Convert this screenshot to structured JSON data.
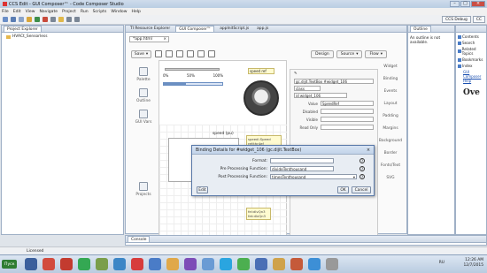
{
  "window": {
    "title": "CCS Edit - GUI Composer™ - Code Composer Studio"
  },
  "menu": [
    "File",
    "Edit",
    "View",
    "Navigate",
    "Project",
    "Run",
    "Scripts",
    "Window",
    "Help"
  ],
  "perspectives": [
    "CCS Debug",
    "CC"
  ],
  "explorer": {
    "tab": "Project Explorer",
    "items": [
      "HVACt_Sensorless"
    ]
  },
  "editor": {
    "tabs": [
      "TI Resource Explorer",
      "GUI Composer™",
      "appInitScript.js",
      "app.js"
    ],
    "file_tab": "*app.html",
    "save": "Save",
    "design": "Design",
    "source": "Source",
    "flow": "Flow",
    "palette": [
      "Palette",
      "Outline",
      "GUI Vars",
      "Projects"
    ],
    "slider_labels": [
      "0%",
      "50%",
      "100%"
    ],
    "progress_pct": 38,
    "speed_ref": "speed ref",
    "chart_label": "speed (pu)",
    "note1": [
      "speedl.Speed",
      "ref:thr4ef"
    ],
    "note2": [
      "fel:dlvQn3",
      "fet:dlvQn3"
    ],
    "side_tabs": [
      "Widget",
      "Binding",
      "Events",
      "Layout",
      "Padding",
      "Margins",
      "Background",
      "Border",
      "Fonts/Text",
      "SVG"
    ],
    "props": {
      "title": "gc.dijit.TextBox #widget_106",
      "class_field": "class",
      "id_field": "id  widget_106",
      "rows": [
        {
          "label": "Value",
          "value": "SpeedRef"
        },
        {
          "label": "Disabled",
          "value": ""
        },
        {
          "label": "Visible",
          "value": ""
        },
        {
          "label": "Read Only",
          "value": ""
        }
      ]
    }
  },
  "dialog": {
    "title": "Binding Details for #widget_106 (gc.dijit.TextBox)",
    "close": "×",
    "format_label": "Format:",
    "format_value": "",
    "pre_label": "Pre Processing Function:",
    "pre_value": "divideTenthousand",
    "post_label": "Post Processing Function:",
    "post_value": "timesTenthousand",
    "help": "?",
    "edit": "Edit",
    "ok": "OK",
    "cancel": "Cancel"
  },
  "outline": {
    "tab": "Outline",
    "message": "An outline is not available."
  },
  "help": {
    "items": [
      "Contents",
      "Search",
      "Related Topics",
      "Bookmarks",
      "Index"
    ],
    "link": "GUI Composer Help",
    "heading": "Ove"
  },
  "console": {
    "tab": "Console"
  },
  "status": {
    "text": "Licensed"
  },
  "taskbar": {
    "start": "Пуск",
    "lang": "RU",
    "time": "12:26 AM",
    "date": "12/7/2015"
  },
  "colors": {
    "title_bg": "#c3d5ea",
    "dialog_border": "#5878a8",
    "note_bg": "#fffbd0"
  }
}
